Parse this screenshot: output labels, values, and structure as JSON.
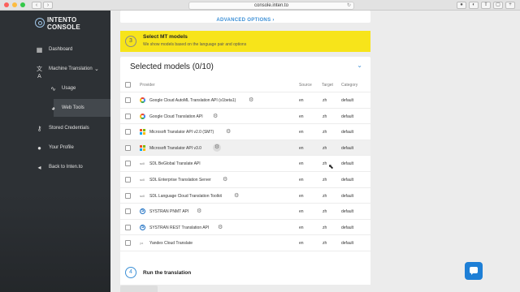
{
  "browser": {
    "url": "console.inten.to",
    "nav_back": "‹",
    "nav_forward": "›",
    "reload": "↻"
  },
  "sidebar": {
    "logo_text": "INTENTO CONSOLE",
    "items": [
      {
        "label": "Dashboard",
        "icon": "dashboard-icon"
      },
      {
        "label": "Machine Translation",
        "icon": "translate-icon"
      },
      {
        "label": "Usage",
        "icon": "chart-line-icon"
      },
      {
        "label": "Web Tools",
        "icon": "palette-icon"
      },
      {
        "label": "Stored Credentials",
        "icon": "key-icon"
      },
      {
        "label": "Your Profile",
        "icon": "person-icon"
      },
      {
        "label": "Back to Inten.to",
        "icon": "arrow-left-icon"
      }
    ]
  },
  "main": {
    "advanced_options": "ADVANCED OPTIONS",
    "advanced_chev": "›",
    "step3": {
      "number": "3",
      "title": "Select MT models",
      "description": "We show models based on the language pair and options"
    },
    "selected_models": {
      "title": "Selected models (0/10)",
      "collapse_glyph": "⌄",
      "headers": {
        "provider": "Provider",
        "source": "Source",
        "target": "Target",
        "category": "Category"
      },
      "rows": [
        {
          "provider": "Google Cloud AutoML Translation API (v1beta1)",
          "source": "en",
          "target": "zh",
          "category": "default",
          "icon": "google-cloud-icon",
          "gear": true
        },
        {
          "provider": "Google Cloud Translation API",
          "source": "en",
          "target": "zh",
          "category": "default",
          "icon": "google-cloud-icon",
          "gear": true
        },
        {
          "provider": "Microsoft Translator API v2.0 (SMT)",
          "source": "en",
          "target": "zh",
          "category": "default",
          "icon": "microsoft-icon",
          "gear": true
        },
        {
          "provider": "Microsoft Translator API v3.0",
          "source": "en",
          "target": "zh",
          "category": "default",
          "icon": "microsoft-icon",
          "gear": true,
          "highlighted": true
        },
        {
          "provider": "SDL BeGlobal Translate API",
          "source": "en",
          "target": "zh",
          "category": "default",
          "icon": "sdl-icon",
          "gear": false
        },
        {
          "provider": "SDL Enterprise Translation Server",
          "source": "en",
          "target": "zh",
          "category": "default",
          "icon": "sdl-icon",
          "gear": true
        },
        {
          "provider": "SDL Language Cloud Translation Toolkit",
          "source": "en",
          "target": "zh",
          "category": "default",
          "icon": "sdl-icon",
          "gear": true
        },
        {
          "provider": "SYSTRAN PNMT API",
          "source": "en",
          "target": "zh",
          "category": "default",
          "icon": "systran-icon",
          "gear": true
        },
        {
          "provider": "SYSTRAN REST Translation API",
          "source": "en",
          "target": "zh",
          "category": "default",
          "icon": "systran-icon",
          "gear": true
        },
        {
          "provider": "Yandex Cloud Translate",
          "source": "en",
          "target": "zh",
          "category": "default",
          "icon": "yandex-icon",
          "gear": false
        }
      ]
    },
    "step4": {
      "number": "4",
      "title": "Run the translation"
    }
  },
  "colors": {
    "accent": "#3b8fd6",
    "step_yellow": "#f7e41a",
    "sidebar_bg": "#2d3135",
    "chat_blue": "#1e7fd6"
  }
}
